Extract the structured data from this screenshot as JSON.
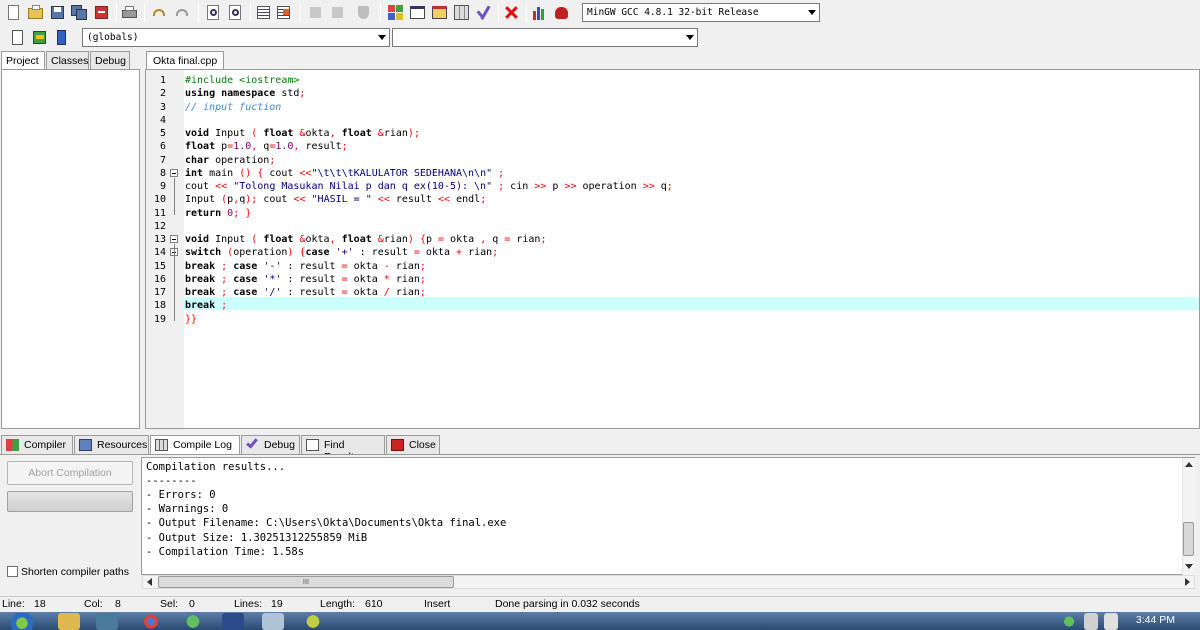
{
  "compiler": {
    "selected": "MinGW GCC 4.8.1 32-bit Release"
  },
  "scope": {
    "selected": "(globals)",
    "second": ""
  },
  "left_tabs": [
    "Project",
    "Classes",
    "Debug"
  ],
  "editor": {
    "file_tab": "Okta final.cpp",
    "current_line": 18,
    "lines": [
      "#include <iostream>",
      "using namespace std;",
      "// input fuction",
      "",
      "void Input ( float &okta, float &rian);",
      "float p=1.0, q=1.0, result;",
      "char operation;",
      "int main () { cout <<\"\\t\\t\\tKALULATOR SEDEHANA\\n\\n\" ;",
      "cout << \"Tolong Masukan Nilai p dan q ex(10-5): \\n\" ; cin >> p >> operation >> q;",
      "Input (p,q); cout << \"HASIL = \" << result << endl;",
      "return 0; }",
      "",
      "void Input ( float &okta, float &rian) {p = okta , q = rian;",
      "switch (operation) {case '+' : result = okta + rian;",
      "break ; case '-' : result = okta - rian;",
      "break ; case '*' : result = okta * rian;",
      "break ; case '/' : result = okta / rian;",
      "break ;",
      "}}"
    ]
  },
  "bottom_tabs": [
    "Compiler",
    "Resources",
    "Compile Log",
    "Debug",
    "Find Results",
    "Close"
  ],
  "compile": {
    "abort_label": "Abort Compilation",
    "shorten_label": "Shorten compiler paths",
    "log": [
      "Compilation results...",
      "--------",
      "- Errors: 0",
      "- Warnings: 0",
      "- Output Filename: C:\\Users\\Okta\\Documents\\Okta final.exe",
      "- Output Size: 1.30251312255859 MiB",
      "- Compilation Time: 1.58s"
    ],
    "hscroll_grip": "III"
  },
  "status": {
    "line_label": "Line:",
    "line": "18",
    "col_label": "Col:",
    "col": "8",
    "sel_label": "Sel:",
    "sel": "0",
    "lines_label": "Lines:",
    "lines": "19",
    "length_label": "Length:",
    "length": "610",
    "mode": "Insert",
    "message": "Done parsing in 0.032 seconds"
  },
  "taskbar": {
    "clock": "3:44 PM"
  },
  "colors": {
    "current_line": "#ccffff",
    "preprocessor": "#008000",
    "comment": "#3c8cdc",
    "string": "#000080",
    "number": "#800080",
    "symbol": "#ff0000"
  }
}
